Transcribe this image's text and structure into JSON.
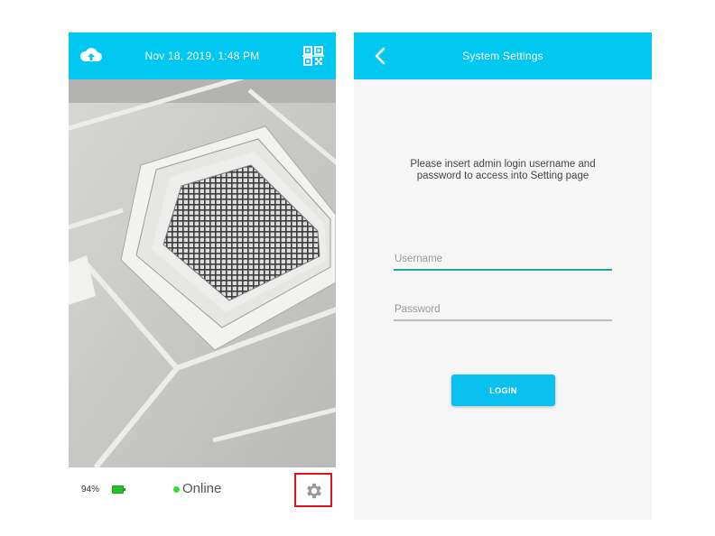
{
  "left_screen": {
    "header": {
      "datetime": "Nov 18, 2019, 1:48 PM",
      "left_icon": "cloud-upload-icon",
      "right_icon": "qr-scan-icon"
    },
    "camera_view": {
      "subject": "ceiling air vent"
    },
    "footer": {
      "battery_percent": "94%",
      "battery_icon": "battery-icon",
      "status_text": "Online",
      "status_color": "#33dd33",
      "settings_icon": "gear-icon",
      "highlight_color": "#e0121a"
    }
  },
  "right_screen": {
    "header": {
      "title": "System Settings",
      "back_icon": "chevron-left-icon"
    },
    "prompt": "Please insert admin login username and password to access into Setting page",
    "username": {
      "placeholder": "Username",
      "value": ""
    },
    "password": {
      "placeholder": "Password",
      "value": ""
    },
    "login_label": "LOGIN"
  },
  "colors": {
    "header_bg": "#00c8f0",
    "accent_underline": "#1ba79a",
    "button_bg": "#0ac0ef"
  }
}
